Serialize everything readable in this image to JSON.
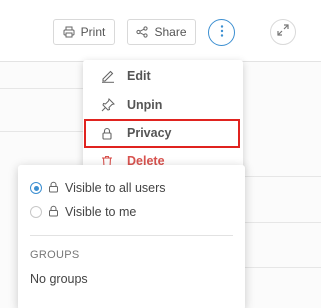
{
  "toolbar": {
    "print_label": "Print",
    "share_label": "Share",
    "more_icon": "vertical-ellipsis-icon",
    "expand_icon": "expand-arrows-icon"
  },
  "actions_menu": {
    "items": [
      {
        "label": "Edit",
        "icon": "pencil-icon"
      },
      {
        "label": "Unpin",
        "icon": "pin-icon"
      },
      {
        "label": "Privacy",
        "icon": "lock-icon",
        "highlighted": true
      },
      {
        "label": "Delete",
        "icon": "trash-icon",
        "color": "#d9534f"
      }
    ]
  },
  "privacy_submenu": {
    "options": [
      {
        "label": "Visible to all users",
        "selected": true
      },
      {
        "label": "Visible to me",
        "selected": false
      }
    ],
    "groups_heading": "GROUPS",
    "groups_empty": "No groups"
  },
  "colors": {
    "accent": "#3c8fd1",
    "highlight_border": "#e0231f",
    "danger": "#d9534f"
  }
}
